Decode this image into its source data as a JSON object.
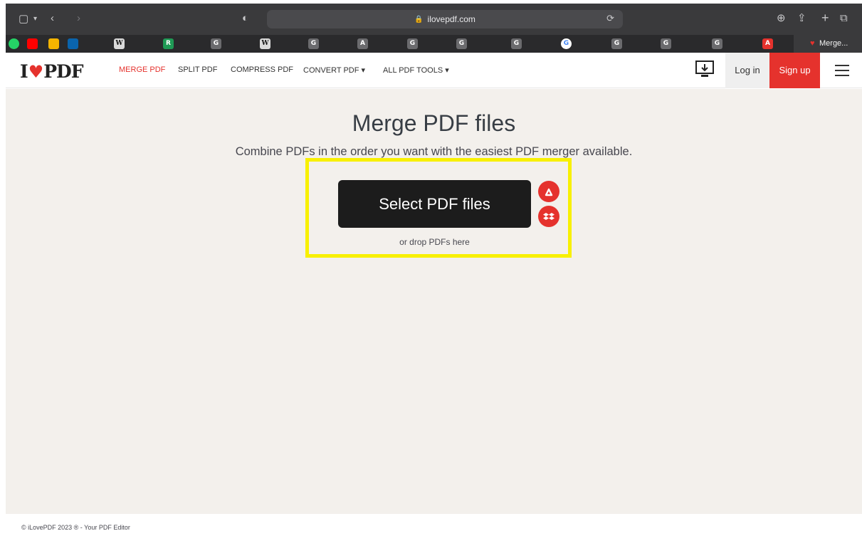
{
  "browser": {
    "url": "ilovepdf.com",
    "bookmark_letters": [
      "W",
      "R",
      "G",
      "W",
      "G",
      "A",
      "G",
      "G",
      "G",
      "G",
      "G",
      "G",
      "G",
      "A"
    ],
    "active_tab": "Merge..."
  },
  "nav": {
    "logo_left": "I",
    "logo_right": "PDF",
    "links": [
      "MERGE PDF",
      "SPLIT PDF",
      "COMPRESS PDF",
      "CONVERT PDF ▾",
      "ALL PDF TOOLS ▾"
    ],
    "login": "Log in",
    "signup": "Sign up"
  },
  "main": {
    "title": "Merge PDF files",
    "subtitle": "Combine PDFs in the order you want with the easiest PDF merger available.",
    "select_button": "Select PDF files",
    "drop_text": "or drop PDFs here"
  },
  "footer": {
    "text": "© iLovePDF 2023 ® - Your PDF Editor"
  },
  "colors": {
    "brand_red": "#e5322d",
    "highlight": "#f8f000",
    "background": "#f3f0ec"
  }
}
